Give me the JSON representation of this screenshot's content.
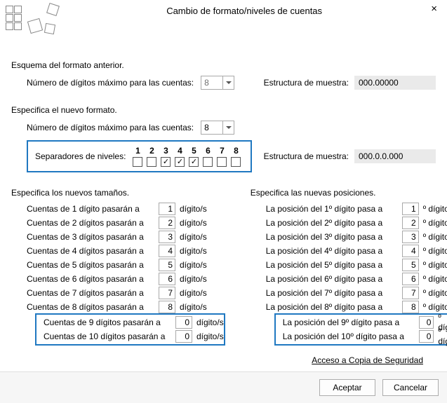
{
  "title": "Cambio de formato/niveles de cuentas",
  "close_glyph": "×",
  "section_prev": "Esquema del formato anterior.",
  "section_new": "Especifica el nuevo formato.",
  "max_digits_label": "Número de dígitos máximo para las cuentas:",
  "prev_digits": "8",
  "new_digits": "8",
  "struct_label": "Estructura de muestra:",
  "struct_prev": "000.00000",
  "struct_new": "000.0.0.000",
  "sep_label": "Separadores de niveles:",
  "sep_cols": [
    "1",
    "2",
    "3",
    "4",
    "5",
    "6",
    "7",
    "8"
  ],
  "sep_checked": [
    false,
    false,
    true,
    true,
    true,
    false,
    false,
    false
  ],
  "sizes": {
    "header": "Especifica los nuevos tamaños.",
    "prefix": "Cuentas de ",
    "suffix_a": " dígito pasarán a",
    "suffix_b": " dígitos pasarán a",
    "unit": "dígito/s",
    "rows": [
      {
        "n": "1",
        "v": "1",
        "pl": "a"
      },
      {
        "n": "2",
        "v": "2",
        "pl": "b"
      },
      {
        "n": "3",
        "v": "3",
        "pl": "b"
      },
      {
        "n": "4",
        "v": "4",
        "pl": "b"
      },
      {
        "n": "5",
        "v": "5",
        "pl": "b"
      },
      {
        "n": "6",
        "v": "6",
        "pl": "b"
      },
      {
        "n": "7",
        "v": "7",
        "pl": "b"
      },
      {
        "n": "8",
        "v": "8",
        "pl": "b"
      },
      {
        "n": "9",
        "v": "0",
        "pl": "b"
      },
      {
        "n": "10",
        "v": "0",
        "pl": "b"
      }
    ]
  },
  "positions": {
    "header": "Especifica las nuevas posiciones.",
    "prefix": "La posición del ",
    "suffix": "º dígito pasa a",
    "unit": "º dígito",
    "rows": [
      {
        "n": "1",
        "v": "1"
      },
      {
        "n": "2",
        "v": "2"
      },
      {
        "n": "3",
        "v": "3"
      },
      {
        "n": "4",
        "v": "4"
      },
      {
        "n": "5",
        "v": "5"
      },
      {
        "n": "6",
        "v": "6"
      },
      {
        "n": "7",
        "v": "7"
      },
      {
        "n": "8",
        "v": "8"
      },
      {
        "n": "9",
        "v": "0"
      },
      {
        "n": "10",
        "v": "0"
      }
    ]
  },
  "backup_link": "Acceso a Copia de Seguridad",
  "btn_accept": "Aceptar",
  "btn_cancel": "Cancelar"
}
